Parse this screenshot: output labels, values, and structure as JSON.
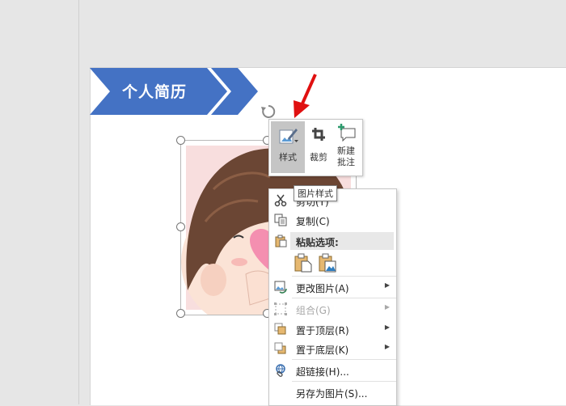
{
  "slide": {
    "banner_title": "个人简历",
    "banner_color": "#4472c4"
  },
  "mini_toolbar": {
    "buttons": [
      {
        "label": "样式",
        "icon": "picture-style-icon",
        "active": true
      },
      {
        "label": "裁剪",
        "icon": "crop-icon"
      },
      {
        "label": "新建\n批注",
        "icon": "new-comment-icon"
      }
    ],
    "tooltip": "图片样式"
  },
  "context_menu": {
    "items": [
      {
        "label": "剪切(T)",
        "icon": "cut-icon",
        "enabled": true
      },
      {
        "label": "复制(C)",
        "icon": "copy-icon",
        "enabled": true
      },
      {
        "label": "粘贴选项:",
        "icon": "paste-icon",
        "header": true
      },
      {
        "label": "更改图片(A)",
        "icon": "change-picture-icon",
        "submenu": true
      },
      {
        "label": "组合(G)",
        "icon": "group-icon",
        "submenu": true,
        "enabled": false
      },
      {
        "label": "置于顶层(R)",
        "icon": "bring-to-front-icon",
        "submenu": true
      },
      {
        "label": "置于底层(K)",
        "icon": "send-to-back-icon",
        "submenu": true
      },
      {
        "label": "超链接(H)...",
        "icon": "hyperlink-icon"
      },
      {
        "label": "另存为图片(S)..."
      }
    ],
    "paste_options": [
      "paste-keep-format-icon",
      "paste-picture-icon"
    ],
    "submenu_arrow": "▶"
  },
  "annotation": {
    "arrow_color": "#e01010"
  }
}
